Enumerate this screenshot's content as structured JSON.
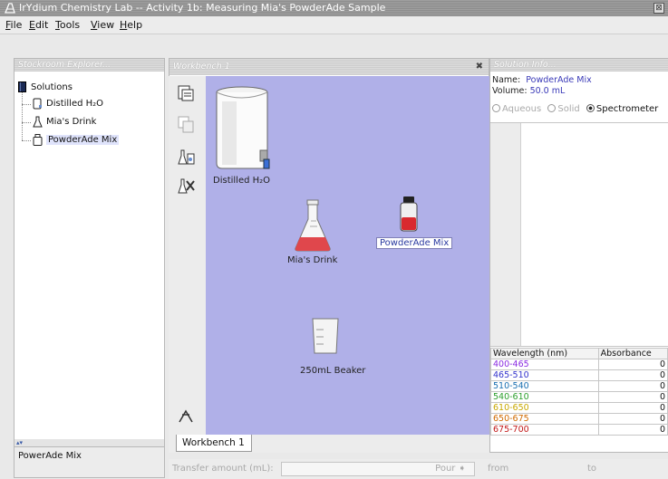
{
  "window": {
    "title": "IrYdium Chemistry Lab -- Activity 1b: Measuring Mia's PowderAde Sample",
    "close_glyph": "⊠"
  },
  "menu": [
    "File",
    "Edit",
    "Tools",
    "View",
    "Help"
  ],
  "stockroom": {
    "header": "Stockroom Explorer...",
    "root_label": "Solutions",
    "items": [
      {
        "label": "Distilled H₂O",
        "icon": "water-bottle-icon"
      },
      {
        "label": "Mia's Drink",
        "icon": "flask-icon"
      },
      {
        "label": "PowderAde Mix",
        "icon": "bottle-icon",
        "selected": true
      }
    ],
    "scroll_arrows": "▴▾",
    "bottom_label": "PowerAde Mix"
  },
  "workbench": {
    "header": "Workbench 1",
    "close_glyph": "✖",
    "tab_label": "Workbench 1",
    "items": [
      {
        "label": "Distilled H₂O",
        "kind": "water-carboy"
      },
      {
        "label": "Mia's Drink",
        "kind": "erlenmeyer-flask"
      },
      {
        "label": "PowderAde Mix",
        "kind": "reagent-bottle",
        "selected": true
      },
      {
        "label": "250mL Beaker",
        "kind": "beaker"
      }
    ]
  },
  "transfer": {
    "label": "Transfer amount (mL):",
    "pour_label": "Pour",
    "from_label": "from",
    "to_label": "to"
  },
  "solution_info": {
    "header": "Solution Info...",
    "name_key": "Name:",
    "name_value": "PowderAde Mix",
    "volume_key": "Volume:",
    "volume_value": "50.0 mL",
    "views": [
      {
        "label": "Aqueous",
        "selected": false
      },
      {
        "label": "Solid",
        "selected": false
      },
      {
        "label": "Spectrometer",
        "selected": true
      }
    ],
    "table": {
      "headers": [
        "Wavelength (nm)",
        "Absorbance"
      ],
      "rows": [
        {
          "range": "400-465",
          "value": "0",
          "color": "#8a2be2"
        },
        {
          "range": "465-510",
          "value": "0",
          "color": "#3333cc"
        },
        {
          "range": "510-540",
          "value": "0",
          "color": "#1a6fb0"
        },
        {
          "range": "540-610",
          "value": "0",
          "color": "#2ea02e"
        },
        {
          "range": "610-650",
          "value": "0",
          "color": "#c8a800"
        },
        {
          "range": "650-675",
          "value": "0",
          "color": "#d06a00"
        },
        {
          "range": "675-700",
          "value": "0",
          "color": "#c21818"
        }
      ]
    }
  }
}
